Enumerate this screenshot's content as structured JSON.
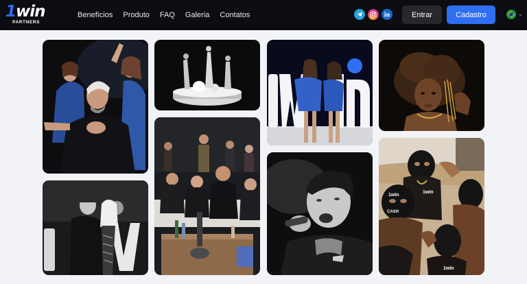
{
  "header": {
    "logo": {
      "number": "1",
      "word": "win",
      "sub": "PARTNERS"
    },
    "nav": [
      "Benefícios",
      "Produto",
      "FAQ",
      "Galeria",
      "Contatos"
    ],
    "socials": [
      "telegram-icon",
      "instagram-icon",
      "linkedin-icon"
    ],
    "login_label": "Entrar",
    "signup_label": "Cadastro",
    "language_flag": "brazil-flag-icon"
  },
  "gallery": {
    "photos": [
      {
        "name": "photo-party-dj-crowd",
        "subject": "man gesturing with women in blue jackets",
        "mono": false
      },
      {
        "name": "photo-stage-dancers",
        "subject": "three dancers on round stage",
        "mono": true
      },
      {
        "name": "photo-women-blue-jackets",
        "subject": "two women in blue jackets with 1win letters",
        "mono": false
      },
      {
        "name": "photo-woman-portrait",
        "subject": "woman portrait with gold jewelry",
        "mono": false
      },
      {
        "name": "photo-couple-1win-sign",
        "subject": "couple posing by 1win sign",
        "mono": true
      },
      {
        "name": "photo-group-lounge",
        "subject": "group seated at lounge table",
        "mono": false
      },
      {
        "name": "photo-rapper-mic",
        "subject": "performer singing into microphone",
        "mono": true
      },
      {
        "name": "photo-women-masks",
        "subject": "women in 1win balaclavas in desert",
        "mono": false
      }
    ],
    "mask_text": "1win",
    "cash_text": "CASH"
  },
  "colors": {
    "header_bg": "#0b0d12",
    "accent": "#2e6ff2",
    "page_bg": "#f1f3f7"
  }
}
